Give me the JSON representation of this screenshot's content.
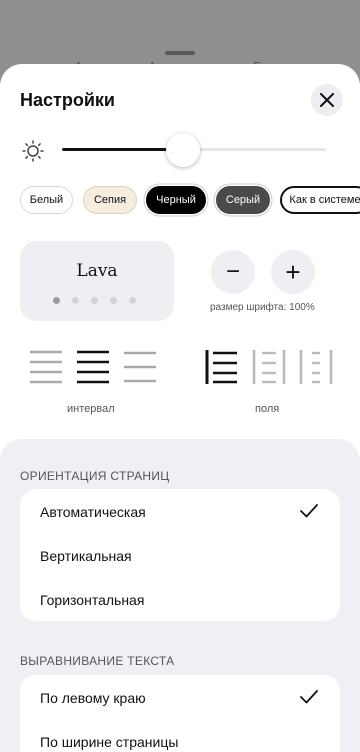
{
  "backdrop": {
    "fragments": [
      "А",
      "А",
      "Б"
    ]
  },
  "settings": {
    "title": "Настройки",
    "close_icon": "close-icon",
    "brightness": {
      "icon": "sun-icon",
      "level": 0.46
    },
    "themes": [
      {
        "label": "Белый",
        "bg": "#ffffff",
        "fg": "#111111",
        "border": "#d8d8dc",
        "selected": false
      },
      {
        "label": "Сепия",
        "bg": "#f5eede",
        "fg": "#111111",
        "border": "#d8d2c0",
        "selected": false
      },
      {
        "label": "Черный",
        "bg": "#000000",
        "fg": "#ffffff",
        "border": "#000000",
        "selected": false
      },
      {
        "label": "Серый",
        "bg": "#4a4a4a",
        "fg": "#ffffff",
        "border": "#4a4a4a",
        "selected": false
      },
      {
        "label": "Как в системе",
        "bg": "#ffffff",
        "fg": "#111111",
        "border": "#111111",
        "selected": true
      }
    ],
    "font": {
      "name": "Lava",
      "pages": 5,
      "active_page": 0,
      "decrease_symbol": "−",
      "increase_symbol": "+",
      "size_label": "размер шрифта: 100%"
    },
    "spacing": {
      "label": "интервал",
      "options": [
        "spacing-wide-icon",
        "spacing-medium-icon",
        "spacing-narrow-icon"
      ],
      "selected_index": 1
    },
    "margins": {
      "label": "поля",
      "options": [
        "margins-small-icon",
        "margins-medium-icon",
        "margins-large-icon"
      ],
      "selected_index": 0
    },
    "orientation": {
      "title": "ОРИЕНТАЦИЯ СТРАНИЦ",
      "options": [
        "Автоматическая",
        "Вертикальная",
        "Горизонтальная"
      ],
      "selected_index": 0
    },
    "alignment": {
      "title": "ВЫРАВНИВАНИЕ ТЕКСТА",
      "options": [
        "По левому краю",
        "По ширине страницы"
      ],
      "selected_index": 0
    }
  },
  "colors": {
    "accent": "#111111",
    "sheet": "#ffffff",
    "section_bg": "#f0f0f4"
  }
}
